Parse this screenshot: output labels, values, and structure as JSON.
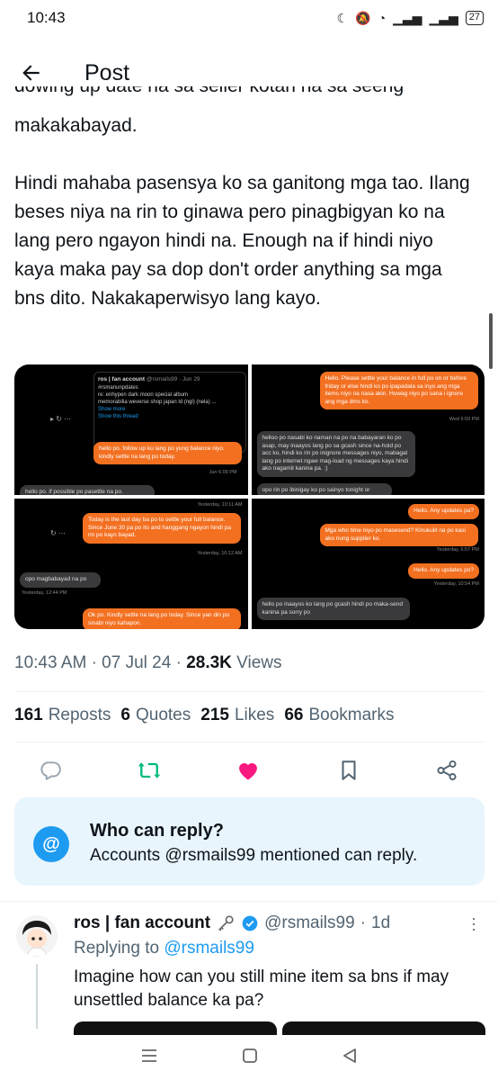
{
  "status": {
    "time": "10:43",
    "battery": "27"
  },
  "header": {
    "title": "Post"
  },
  "post": {
    "clipped_line": "dowing up date na sa seller kotan na sa seeng",
    "paragraph1_line": "makakabayad.",
    "paragraph2": "Hindi mahaba pasensya ko sa ganitong mga tao. Ilang beses niya na rin to ginawa pero pinagbigyan ko na lang pero ngayon hindi na. Enough na if hindi niyo kaya maka pay sa dop don't order anything sa mga bns dito. Nakakaperwisyo lang kayo."
  },
  "media": {
    "shot1": {
      "quote_name": "ros | fan account",
      "quote_handle": "@rsmails99 · Jun 29",
      "quote_lines": [
        "#rsmanunpdates",
        "re: enhypen dark moon special album",
        "memorabilia weverse shop japan ld (ngl) (nela) ..."
      ],
      "show_more": "Show more",
      "show_thread": "Show this thread",
      "msg1": "hello po. follow up ku lang po yung balance niyo. kindly settle na lang po today.",
      "time1": "Jun 6:09 PM",
      "msg2": "hello po. if possible po pasettle na po."
    },
    "shot2": {
      "msg1": "Hello. Please settle your balance in full po on or before friday or else hindi ko po ipapadala sa inyo ang mga items niyo na nasa akin. Huwag niyo po sana i ignore ang mga dms ko.",
      "time1": "Wed 6:59 PM",
      "msg2": "helloo po nasabi ko naman na po na babayaran ko po asap, may inaayos lang po sa gcash since na-hold po acc ko, hindi ko rin po inignore messages niyo, mabagal lang po internet ngaw mag-load ng messages kaya hindi ako nagamit kanina pa. :)",
      "msg3": "opo rin po ibinigay ko po sainyo tonight or"
    },
    "shot3": {
      "time0": "Yesterday, 10:11 AM",
      "msg1": "Today is the last day ba po to settle your full balance. Since June 30 pa po ito and hanggang ngayon hindi pa rin po kayo bayad.",
      "time1": "Yesterday, 10:12 AM",
      "msg2": "opo magbabayad na po",
      "time2": "Yesterday, 12:44 PM",
      "msg3": "Ok po. Kindly settle na lang po today. Since yan din po sinabi niyo kahapon."
    },
    "shot4": {
      "msg1": "Hello. Any updates pa?",
      "msg2": "Mga who time niyo po masesend? Kinukulit na po kasi ako nung supplier ko.",
      "time1": "Yesterday, 6:57 PM",
      "msg3": "Hello. Any updates po?",
      "time2": "Yesterday, 10:54 PM",
      "msg4": "hello po inaayos ko lang po gcash hindi po maka-send kanina pa sorry po"
    }
  },
  "meta": {
    "time": "10:43 AM",
    "date": "07 Jul 24",
    "views_count": "28.3K",
    "views_label": "Views",
    "sep": "·"
  },
  "stats": [
    {
      "count": "161",
      "label": "Reposts"
    },
    {
      "count": "6",
      "label": "Quotes"
    },
    {
      "count": "215",
      "label": "Likes"
    },
    {
      "count": "66",
      "label": "Bookmarks"
    }
  ],
  "colors": {
    "like_active": "#f91880",
    "repost_active": "#00ba7c",
    "accent": "#1d9bf0"
  },
  "reply_settings": {
    "title": "Who can reply?",
    "subtitle": "Accounts @rsmails99 mentioned can reply."
  },
  "reply": {
    "name": "ros | fan account",
    "handle": "@rsmails99",
    "sep": "·",
    "age": "1d",
    "replying_prefix": "Replying to",
    "replying_to": "@rsmails99",
    "text": "Imagine how can you still mine item sa bns if may unsettled balance ka pa?"
  }
}
